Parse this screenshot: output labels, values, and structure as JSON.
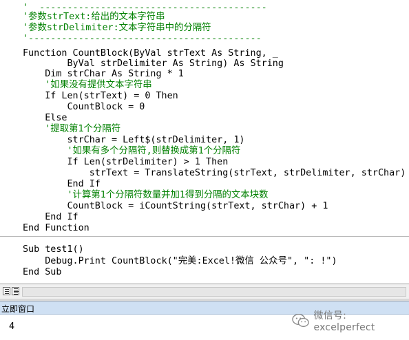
{
  "code": {
    "lines": [
      {
        "text": "'  -----------------------------------------",
        "kind": "comment"
      },
      {
        "text": "'参数strText:给出的文本字符串",
        "kind": "comment"
      },
      {
        "text": "'参数strDelimiter:文本字符串中的分隔符",
        "kind": "comment"
      },
      {
        "text": "'------------------------------------------",
        "kind": "comment"
      },
      {
        "text": "Function CountBlock(ByVal strText As String, _",
        "kind": "code"
      },
      {
        "text": "        ByVal strDelimiter As String) As String",
        "kind": "code"
      },
      {
        "text": "    Dim strChar As String * 1",
        "kind": "code"
      },
      {
        "text": "    '如果没有提供文本字符串",
        "kind": "comment"
      },
      {
        "text": "    If Len(strText) = 0 Then",
        "kind": "code"
      },
      {
        "text": "        CountBlock = 0",
        "kind": "code"
      },
      {
        "text": "    Else",
        "kind": "code"
      },
      {
        "text": "    '提取第1个分隔符",
        "kind": "comment"
      },
      {
        "text": "        strChar = Left$(strDelimiter, 1)",
        "kind": "code"
      },
      {
        "text": "        '如果有多个分隔符,则替换成第1个分隔符",
        "kind": "comment"
      },
      {
        "text": "        If Len(strDelimiter) > 1 Then",
        "kind": "code"
      },
      {
        "text": "            strText = TranslateString(strText, strDelimiter, strChar)",
        "kind": "code"
      },
      {
        "text": "        End If",
        "kind": "code"
      },
      {
        "text": "        '计算第1个分隔符数量并加1得到分隔的文本块数",
        "kind": "comment"
      },
      {
        "text": "        CountBlock = iCountString(strText, strChar) + 1",
        "kind": "code"
      },
      {
        "text": "    End If",
        "kind": "code"
      },
      {
        "text": "End Function",
        "kind": "code"
      },
      {
        "text": "",
        "kind": "blank"
      },
      {
        "text": "Sub test1()",
        "kind": "code"
      },
      {
        "text": "    Debug.Print CountBlock(\"完美:Excel!微信 公众号\", \": !\")",
        "kind": "code"
      },
      {
        "text": "End Sub",
        "kind": "code"
      }
    ]
  },
  "colors": {
    "comment": "#008000",
    "code": "#000000",
    "immediate_title_bg": "#cfe0f3"
  },
  "view_buttons": {
    "procedure_view_icon": "procedure-view-icon",
    "full_module_view_icon": "full-module-view-icon"
  },
  "immediate": {
    "title": "立即窗口",
    "output": "4"
  },
  "watermark": {
    "icon": "wechat-icon",
    "text": "微信号: excelperfect"
  }
}
